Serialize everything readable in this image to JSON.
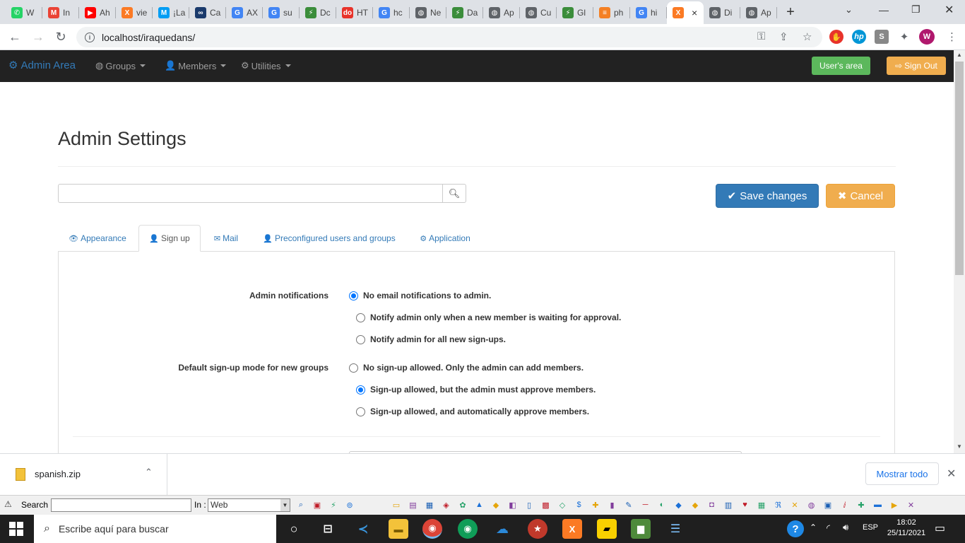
{
  "browser": {
    "tabs": [
      {
        "label": "W",
        "icon": "whatsapp-icon",
        "color": "#25d366",
        "glyph": "✆"
      },
      {
        "label": "In",
        "icon": "gmail-icon",
        "color": "#ea4335",
        "glyph": "M"
      },
      {
        "label": "Ah",
        "icon": "youtube-icon",
        "color": "#ff0000",
        "glyph": "▶"
      },
      {
        "label": "vie",
        "icon": "xampp-icon",
        "color": "#fb7a24",
        "glyph": "X"
      },
      {
        "label": "¡La",
        "icon": "movistar-icon",
        "color": "#019df4",
        "glyph": "M"
      },
      {
        "label": "Ca",
        "icon": "link-icon",
        "color": "#1a3a6c",
        "glyph": "∞"
      },
      {
        "label": "AX",
        "icon": "google-icon",
        "color": "#4285f4",
        "glyph": "G"
      },
      {
        "label": "su",
        "icon": "google-icon",
        "color": "#4285f4",
        "glyph": "G"
      },
      {
        "label": "Dc",
        "icon": "bolt-icon",
        "color": "#3b8d3b",
        "glyph": "⚡"
      },
      {
        "label": "HT",
        "icon": "dofactory-icon",
        "color": "#e8332a",
        "glyph": "do"
      },
      {
        "label": "hc",
        "icon": "google-icon",
        "color": "#4285f4",
        "glyph": "G"
      },
      {
        "label": "Ne",
        "icon": "globe-icon",
        "color": "#5f6368",
        "glyph": "◍"
      },
      {
        "label": "Da",
        "icon": "bolt-icon",
        "color": "#3b8d3b",
        "glyph": "⚡"
      },
      {
        "label": "Ap",
        "icon": "globe-icon",
        "color": "#5f6368",
        "glyph": "◍"
      },
      {
        "label": "Cu",
        "icon": "globe-icon",
        "color": "#5f6368",
        "glyph": "◍"
      },
      {
        "label": "Gl",
        "icon": "bolt-icon",
        "color": "#3b8d3b",
        "glyph": "⚡"
      },
      {
        "label": "ph",
        "icon": "stackoverflow-icon",
        "color": "#f48024",
        "glyph": "≡"
      },
      {
        "label": "hi",
        "icon": "google-icon",
        "color": "#4285f4",
        "glyph": "G"
      },
      {
        "label": "",
        "icon": "xampp-icon",
        "color": "#fb7a24",
        "glyph": "X",
        "active": true
      },
      {
        "label": "Di",
        "icon": "globe-icon",
        "color": "#5f6368",
        "glyph": "◍"
      },
      {
        "label": "Ap",
        "icon": "globe-icon",
        "color": "#5f6368",
        "glyph": "◍"
      }
    ],
    "url": "localhost/iraquedans/",
    "profile_initial": "W"
  },
  "navbar": {
    "brand": "Admin Area",
    "menus": [
      "Groups",
      "Members",
      "Utilities"
    ],
    "users_area": "User's area",
    "sign_out": "Sign Out"
  },
  "page": {
    "title": "Admin Settings",
    "search_placeholder": "",
    "save_label": "Save changes",
    "cancel_label": "Cancel",
    "tabs": [
      {
        "label": "Appearance",
        "icon": "eye-icon",
        "glyph": "👁"
      },
      {
        "label": "Sign up",
        "icon": "user-icon",
        "glyph": "👤",
        "active": true
      },
      {
        "label": "Mail",
        "icon": "envelope-icon",
        "glyph": "✉"
      },
      {
        "label": "Preconfigured users and groups",
        "icon": "user-icon",
        "glyph": "👤"
      },
      {
        "label": "Application",
        "icon": "gear-icon",
        "glyph": "⚙"
      }
    ],
    "admin_notifications": {
      "label": "Admin notifications",
      "options": [
        {
          "label": "No email notifications to admin.",
          "checked": true
        },
        {
          "label": "Notify admin only when a new member is waiting for approval.",
          "checked": false
        },
        {
          "label": "Notify admin for all new sign-ups.",
          "checked": false
        }
      ]
    },
    "signup_mode": {
      "label": "Default sign-up mode for new groups",
      "options": [
        {
          "label": "No sign-up allowed. Only the admin can add members.",
          "checked": false
        },
        {
          "label": "Sign-up allowed, but the admin must approve members.",
          "checked": true
        },
        {
          "label": "Sign-up allowed, and automatically approve members.",
          "checked": false
        }
      ]
    }
  },
  "download": {
    "filename": "spanish.zip",
    "show_all": "Mostrar todo"
  },
  "toolbar2": {
    "search_label": "Search :",
    "in_label": "In :",
    "in_value": "Web"
  },
  "taskbar": {
    "search_placeholder": "Escribe aquí para buscar",
    "lang": "ESP",
    "time": "18:02",
    "date": "25/11/2021"
  },
  "colors": {
    "navbar": "#222222",
    "brand": "#337ab7",
    "success": "#5cb85c",
    "warning": "#f0ad4e",
    "primary": "#337ab7"
  }
}
